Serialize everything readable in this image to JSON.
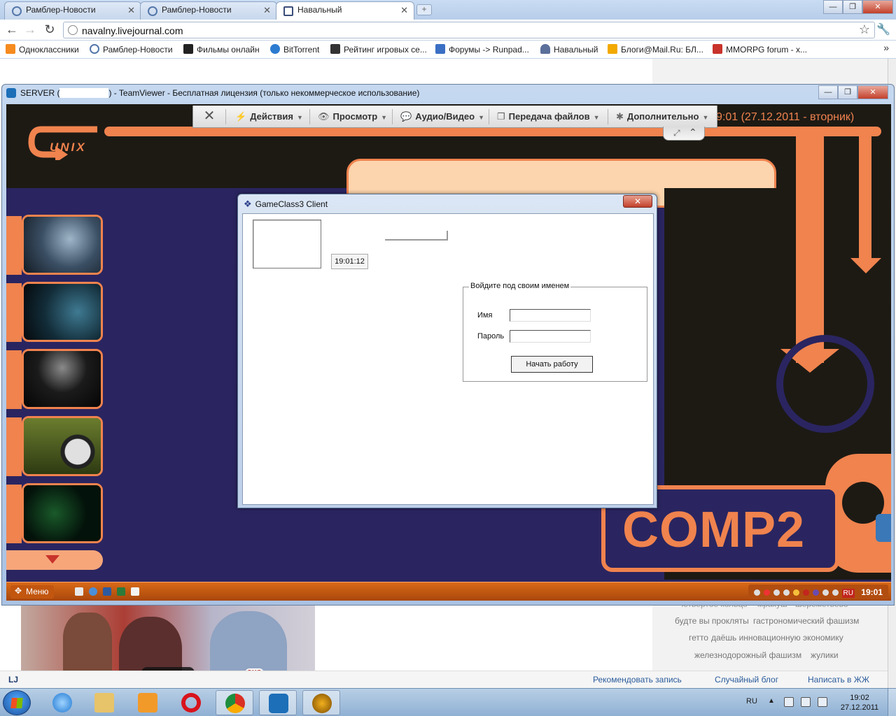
{
  "browser": {
    "tabs": [
      {
        "title": "Рамблер-Новости"
      },
      {
        "title": "Рамблер-Новости"
      },
      {
        "title": "Навальный"
      }
    ],
    "new_tab_label": "+",
    "url": "navalny.livejournal.com",
    "bookmarks": [
      {
        "label": "Одноклассники",
        "color": "#f68b1f"
      },
      {
        "label": "Рамблер-Новости",
        "color": "#5577aa"
      },
      {
        "label": "Фильмы онлайн",
        "color": "#222222"
      },
      {
        "label": "BitTorrent",
        "color": "#2b7bd1"
      },
      {
        "label": "Рейтинг игровых се...",
        "color": "#333333"
      },
      {
        "label": "Форумы -> Runpad...",
        "color": "#3a6fc4"
      },
      {
        "label": "Навальный",
        "color": "#5a6f9a"
      },
      {
        "label": "Блоги@Mail.Ru: БЛ...",
        "color": "#f2a900"
      },
      {
        "label": "MMORPG forum - x...",
        "color": "#c8332b"
      }
    ],
    "bookmarks_more": "»",
    "window_controls": {
      "minimize": "—",
      "maximize": "❐",
      "close": "✕"
    }
  },
  "webpage": {
    "tags": [
      "четвертое кольцо",
      "мракуш",
      "шереметьево",
      "будте вы прокляты",
      "гастрономический фашизм",
      "гетто",
      "даёшь инновационную экономику",
      "железнодорожный фашизм",
      "жулики"
    ],
    "bottom_links": {
      "recommend": "Рекомендовать запись",
      "random_blog": "Случайный блог",
      "write": "Написать в ЖЖ"
    },
    "lj_badge": "LJ",
    "video_badge": "ЭХО"
  },
  "teamviewer": {
    "title_prefix": "SERVER (",
    "title_suffix": ") - TeamViewer - Бесплатная лицензия (только некоммерческое использование)",
    "controls": {
      "minimize": "—",
      "maximize": "❐",
      "close": "✕"
    },
    "toolbar": {
      "close_label": "✕",
      "actions": "Действия",
      "view": "Просмотр",
      "audio_video": "Аудио/Видео",
      "file_transfer": "Передача файлов",
      "extras": "Дополнительно"
    }
  },
  "remote": {
    "logo_text": "UNIX",
    "clock_text": "9:01 (27.12.2011 - вторник)",
    "computer_name": "COMP2",
    "start_label": "Меню",
    "lang": "RU",
    "time": "19:01"
  },
  "gameclass": {
    "title": "GameClass3 Client",
    "close_label": "✕",
    "time_value": "19:01:12",
    "group_title": "Войдите под своим именем",
    "name_label": "Имя",
    "password_label": "Пароль",
    "name_value": "",
    "password_value": "",
    "start_button": "Начать работу"
  },
  "windows_taskbar": {
    "lang": "RU",
    "tray_arrow": "▲",
    "time": "19:02",
    "date": "27.12.2011"
  }
}
